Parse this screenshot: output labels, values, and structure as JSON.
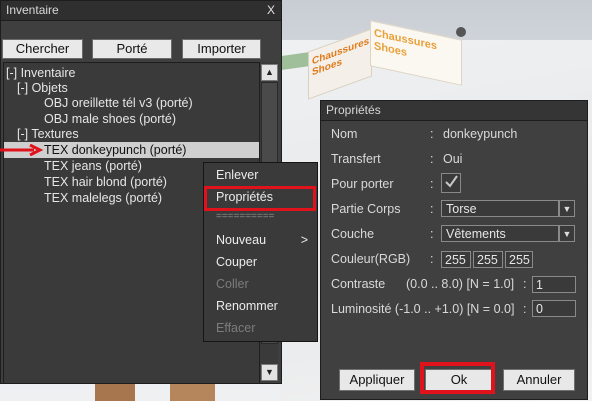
{
  "scene": {
    "box_text_a": "Chaussures Shoes",
    "box_text_b": "Chaussures Shoes"
  },
  "inventory": {
    "title": "Inventaire",
    "close": "X",
    "buttons": [
      "Chercher",
      "Porté",
      "Importer"
    ],
    "tree": [
      {
        "text": "[-] Inventaire",
        "indent": 0
      },
      {
        "text": "[-] Objets",
        "indent": 1
      },
      {
        "text": "OBJ oreillette tél v3 (porté)",
        "indent": 2
      },
      {
        "text": "OBJ male shoes (porté)",
        "indent": 2
      },
      {
        "text": "[-] Textures",
        "indent": 1
      },
      {
        "text": "TEX donkeypunch (porté)",
        "indent": 2,
        "selected": true
      },
      {
        "text": "TEX jeans (porté)",
        "indent": 2
      },
      {
        "text": "TEX hair blond (porté)",
        "indent": 2
      },
      {
        "text": "TEX malelegs (porté)",
        "indent": 2
      }
    ],
    "scroll_up": "▲",
    "scroll_down": "▼"
  },
  "context_menu": {
    "items": [
      {
        "label": "Enlever",
        "enabled": true
      },
      {
        "label": "Propriétés",
        "enabled": true
      },
      {
        "label": "==========",
        "separator": true
      },
      {
        "label": "Nouveau",
        "enabled": true,
        "submenu": ">"
      },
      {
        "label": "Couper",
        "enabled": true
      },
      {
        "label": "Coller",
        "enabled": false
      },
      {
        "label": "Renommer",
        "enabled": true
      },
      {
        "label": "Effacer",
        "enabled": false
      }
    ]
  },
  "properties": {
    "title": "Propriétés",
    "nom_label": "Nom",
    "nom_value": "donkeypunch",
    "transfert_label": "Transfert",
    "transfert_value": "Oui",
    "pour_porter_label": "Pour porter",
    "pour_porter_checked": true,
    "partie_label": "Partie Corps",
    "partie_value": "Torse",
    "couche_label": "Couche",
    "couche_value": "Vêtements",
    "couleur_label": "Couleur(RGB)",
    "couleur_r": "255",
    "couleur_g": "255",
    "couleur_b": "255",
    "contraste_label": "Contraste",
    "contraste_range": "(0.0 .. 8.0)  [N = 1.0]",
    "contraste_value": "1",
    "luminosite_label": "Luminosité (-1.0 .. +1.0) [N = 0.0]",
    "luminosite_value": "0",
    "btn_appliquer": "Appliquer",
    "btn_ok": "Ok",
    "btn_annuler": "Annuler",
    "colon": ":"
  },
  "colors": {
    "highlight": "#e0121b",
    "panel": "#3f3f3f",
    "selection": "#cfcfcf"
  }
}
